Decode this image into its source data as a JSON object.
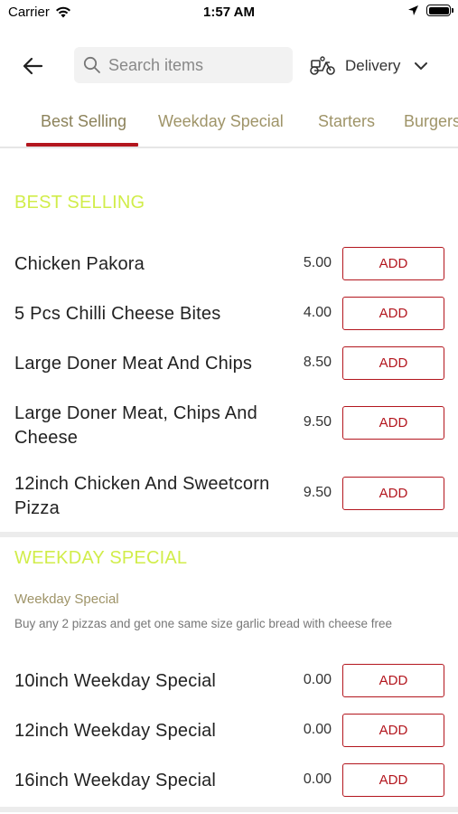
{
  "status_bar": {
    "carrier": "Carrier",
    "time": "1:57 AM",
    "icons": [
      "wifi-icon",
      "location-arrow-icon",
      "battery-icon"
    ]
  },
  "header": {
    "back_icon": "arrow-left-icon",
    "search_placeholder": "Search items",
    "search_value": "",
    "delivery_label": "Delivery",
    "delivery_icon": "scooter-icon",
    "dropdown_icon": "chevron-down-icon"
  },
  "tabs": [
    {
      "label": "Best Selling",
      "active": true
    },
    {
      "label": "Weekday Special",
      "active": false
    },
    {
      "label": "Starters",
      "active": false
    },
    {
      "label": "Burgers",
      "active": false
    }
  ],
  "colors": {
    "accent": "#b3161e",
    "section_title": "#d1ed4a",
    "tab_text": "#9f9468"
  },
  "sections": [
    {
      "title": "BEST SELLING",
      "items": [
        {
          "name": "Chicken Pakora",
          "price": "5.00",
          "button": "ADD"
        },
        {
          "name": "5 Pcs Chilli Cheese Bites",
          "price": "4.00",
          "button": "ADD"
        },
        {
          "name": "Large Doner Meat And Chips",
          "price": "8.50",
          "button": "ADD"
        },
        {
          "name": "Large Doner Meat, Chips And Cheese",
          "price": "9.50",
          "button": "ADD"
        },
        {
          "name": "12inch Chicken And Sweetcorn Pizza",
          "price": "9.50",
          "button": "ADD"
        }
      ]
    },
    {
      "title": "WEEKDAY SPECIAL",
      "subtitle": "Weekday Special",
      "description": "Buy any 2 pizzas and get one same size garlic bread with cheese free",
      "items": [
        {
          "name": "10inch Weekday Special",
          "price": "0.00",
          "button": "ADD"
        },
        {
          "name": "12inch Weekday Special",
          "price": "0.00",
          "button": "ADD"
        },
        {
          "name": "16inch Weekday Special",
          "price": "0.00",
          "button": "ADD"
        }
      ]
    }
  ]
}
